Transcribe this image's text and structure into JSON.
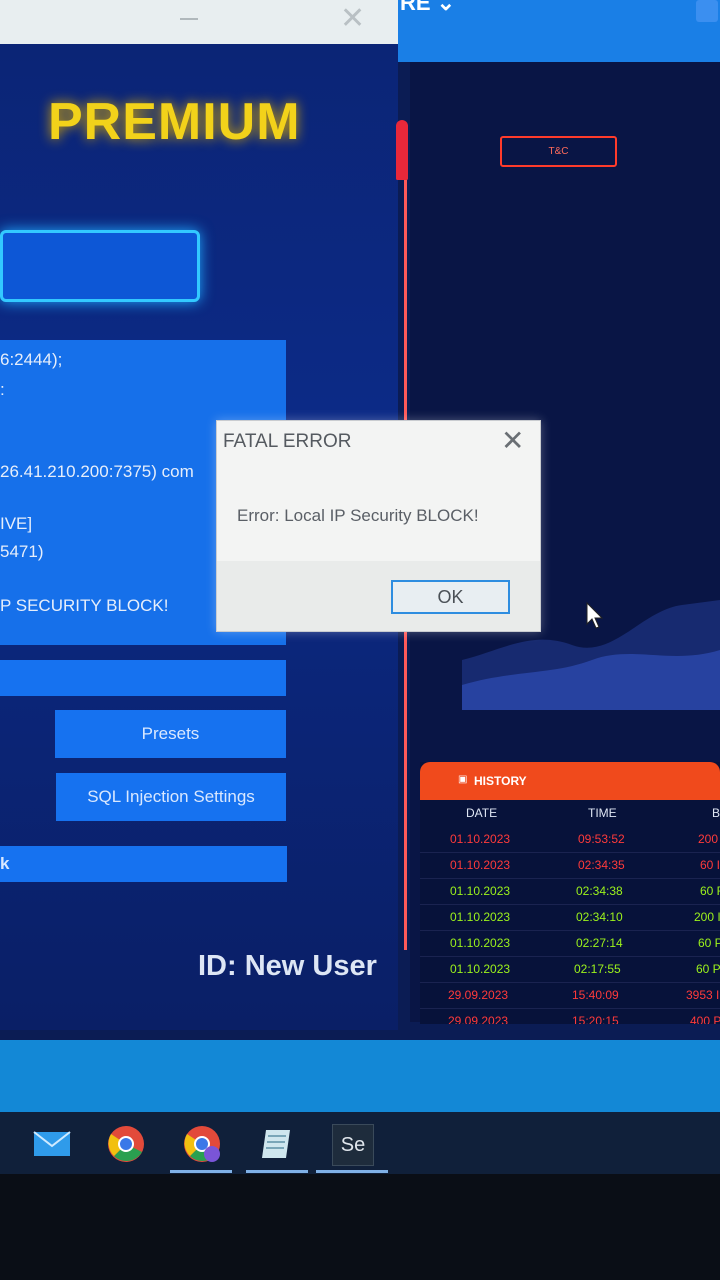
{
  "left_app": {
    "title": "PREMIUM",
    "log_lines": [
      "6:2444);",
      ":",
      "26.41.210.200:7375) com",
      "IVE]",
      "5471)",
      "P SECURITY BLOCK!"
    ],
    "presets_label": "Presets",
    "sql_label": "SQL Injection Settings",
    "bottom_bar_text": "k",
    "id_label": "ID: New User"
  },
  "right_app": {
    "header_chevron": "RE ⌄",
    "tc_label": "T&C",
    "history": {
      "title": "HISTORY",
      "columns": [
        "DATE",
        "TIME",
        "B"
      ],
      "rows": [
        {
          "date": "01.10.2023",
          "time": "09:53:52",
          "amount": "200",
          "status": "loss"
        },
        {
          "date": "01.10.2023",
          "time": "02:34:35",
          "amount": "60 I",
          "status": "loss"
        },
        {
          "date": "01.10.2023",
          "time": "02:34:38",
          "amount": "60 F",
          "status": "win"
        },
        {
          "date": "01.10.2023",
          "time": "02:34:10",
          "amount": "200 I",
          "status": "win"
        },
        {
          "date": "01.10.2023",
          "time": "02:27:14",
          "amount": "60 P",
          "status": "win"
        },
        {
          "date": "01.10.2023",
          "time": "02:17:55",
          "amount": "60 P",
          "status": "win"
        },
        {
          "date": "29.09.2023",
          "time": "15:40:09",
          "amount": "3953 I",
          "status": "loss"
        },
        {
          "date": "29.09.2023",
          "time": "15:20:15",
          "amount": "400 P",
          "status": "loss"
        }
      ]
    }
  },
  "dialog": {
    "title": "FATAL ERROR",
    "message": "Error: Local IP Security BLOCK!",
    "ok_label": "OK"
  },
  "taskbar": {
    "icons": [
      "mail-icon",
      "chrome-icon",
      "chrome-profile-icon",
      "notepad-icon",
      "selenium-icon"
    ],
    "selenium_label": "Se"
  },
  "colors": {
    "accent_blue": "#1670ea",
    "win_green": "#9cf21c",
    "loss_red": "#ff3a3a",
    "premium_yellow": "#f2d21a",
    "history_orange": "#f04a1c"
  }
}
